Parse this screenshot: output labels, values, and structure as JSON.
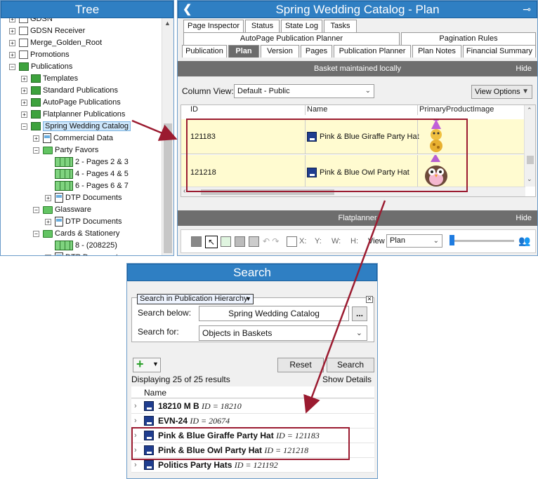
{
  "tree": {
    "title": "Tree",
    "nodes": [
      {
        "label": "GDSN",
        "indent": 0,
        "icon": "box"
      },
      {
        "label": "GDSN Receiver",
        "indent": 0,
        "icon": "box"
      },
      {
        "label": "Merge_Golden_Root",
        "indent": 0,
        "icon": "box"
      },
      {
        "label": "Promotions",
        "indent": 0,
        "icon": "box"
      },
      {
        "label": "Publications",
        "indent": 0,
        "icon": "green"
      },
      {
        "label": "Templates",
        "indent": 1,
        "icon": "green"
      },
      {
        "label": "Standard Publications",
        "indent": 1,
        "icon": "green"
      },
      {
        "label": "AutoPage Publications",
        "indent": 1,
        "icon": "green"
      },
      {
        "label": "Flatplanner Publications",
        "indent": 1,
        "icon": "green"
      },
      {
        "label": "Spring Wedding Catalog",
        "indent": 1,
        "icon": "green",
        "selected": true
      },
      {
        "label": "Commercial Data",
        "indent": 2,
        "icon": "doc"
      },
      {
        "label": "Party Favors",
        "indent": 2,
        "icon": "folder"
      },
      {
        "label": "2 - Pages 2 & 3",
        "indent": 3,
        "icon": "pages"
      },
      {
        "label": "4 - Pages 4 & 5",
        "indent": 3,
        "icon": "pages"
      },
      {
        "label": "6 - Pages 6 & 7",
        "indent": 3,
        "icon": "pages"
      },
      {
        "label": "DTP Documents",
        "indent": 3,
        "icon": "doc"
      },
      {
        "label": "Glassware",
        "indent": 2,
        "icon": "folder"
      },
      {
        "label": "DTP Documents",
        "indent": 3,
        "icon": "doc"
      },
      {
        "label": "Cards & Stationery",
        "indent": 2,
        "icon": "folder"
      },
      {
        "label": "8 - (208225)",
        "indent": 3,
        "icon": "pages"
      },
      {
        "label": "DTP Documents",
        "indent": 3,
        "icon": "doc"
      }
    ]
  },
  "plan": {
    "title": "Spring Wedding Catalog - Plan",
    "tabs_row1": [
      "Page Inspector",
      "Status",
      "State Log",
      "Tasks"
    ],
    "tabs_row2": [
      "AutoPage Publication Planner",
      "Pagination Rules"
    ],
    "tabs_row3": [
      "Publication",
      "Plan",
      "Version",
      "Pages",
      "Publication Planner",
      "Plan Notes",
      "Financial Summary"
    ],
    "active_tab": "Plan",
    "basket_bar": "Basket maintained locally",
    "hide_label": "Hide",
    "column_view_label": "Column View:",
    "column_view_value": "Default - Public",
    "view_options_label": "View Options",
    "columns": [
      "ID",
      "Name",
      "PrimaryProductImage"
    ],
    "rows": [
      {
        "id": "121183",
        "name": "Pink & Blue Giraffe Party Hat"
      },
      {
        "id": "121218",
        "name": "Pink & Blue Owl Party Hat"
      }
    ],
    "flatplanner_bar": "Flatplanner",
    "fp_labels": {
      "x": "X:",
      "y": "Y:",
      "w": "W:",
      "h": "H:",
      "view": "View"
    },
    "fp_view_value": "Plan"
  },
  "search": {
    "title": "Search",
    "mode": "Search in Publication Hierarchy",
    "search_below_label": "Search below:",
    "search_below_value": "Spring Wedding Catalog",
    "browse_label": "...",
    "search_for_label": "Search for:",
    "search_for_value": "Objects in Baskets",
    "reset_label": "Reset",
    "search_label": "Search",
    "status": "Displaying 25 of 25 results",
    "show_details": "Show Details",
    "name_header": "Name",
    "results": [
      {
        "name": "18210 M B",
        "id": "ID = 18210"
      },
      {
        "name": "EVN-24",
        "id": "ID = 20674"
      },
      {
        "name": "Pink & Blue Giraffe Party Hat",
        "id": "ID = 121183"
      },
      {
        "name": "Pink & Blue Owl Party Hat",
        "id": "ID = 121218"
      },
      {
        "name": "Politics Party Hats",
        "id": "ID = 121192"
      }
    ]
  },
  "colors": {
    "header_blue": "#2f7fc3",
    "highlight_red": "#9b1b30",
    "row_yellow": "#fffbd0"
  }
}
